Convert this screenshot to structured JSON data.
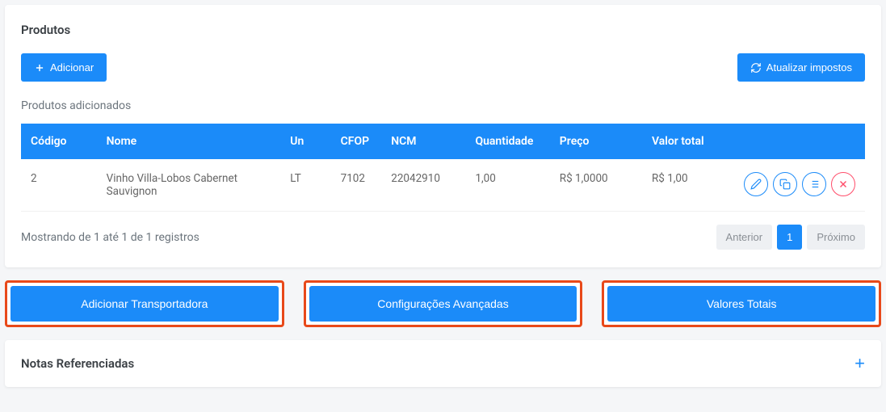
{
  "products_card": {
    "title": "Produtos",
    "add_button": "Adicionar",
    "update_taxes_button": "Atualizar impostos",
    "subtitle": "Produtos adicionados",
    "columns": {
      "codigo": "Código",
      "nome": "Nome",
      "un": "Un",
      "cfop": "CFOP",
      "ncm": "NCM",
      "quantidade": "Quantidade",
      "preco": "Preço",
      "valor_total": "Valor total"
    },
    "rows": [
      {
        "codigo": "2",
        "nome": "Vinho Villa-Lobos Cabernet Sauvignon",
        "un": "LT",
        "cfop": "7102",
        "ncm": "22042910",
        "quantidade": "1,00",
        "preco": "R$ 1,0000",
        "valor_total": "R$ 1,00"
      }
    ],
    "pager_info": "Mostrando de 1 até 1 de 1 registros",
    "pager_prev": "Anterior",
    "pager_page": "1",
    "pager_next": "Próximo"
  },
  "wide_buttons": {
    "transportadora": "Adicionar Transportadora",
    "config": "Configurações Avançadas",
    "valores": "Valores Totais"
  },
  "notas_ref": {
    "title": "Notas Referenciadas"
  }
}
